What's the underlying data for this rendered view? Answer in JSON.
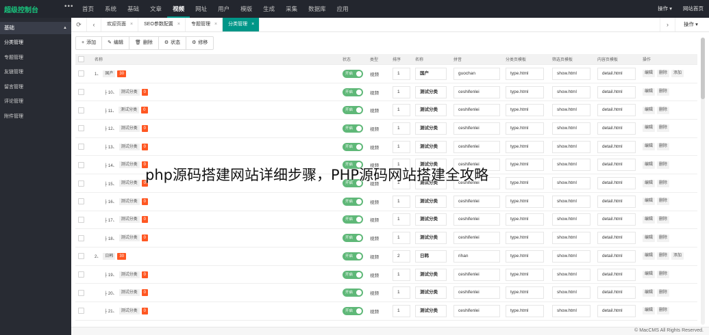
{
  "app": {
    "title": "超级控制台",
    "more": "•••"
  },
  "topnav": [
    "首页",
    "系统",
    "基础",
    "文章",
    "视频",
    "网址",
    "用户",
    "模版",
    "生成",
    "采集",
    "数据库",
    "应用"
  ],
  "topnav_active": 4,
  "top_right": {
    "ops": "操作 ▾",
    "home": "网站首页"
  },
  "sidebar": {
    "header": "基础",
    "items": [
      "分类管理",
      "专题管理",
      "友链管理",
      "留言管理",
      "评论管理",
      "附件管理"
    ],
    "active": 0
  },
  "tabbar": {
    "tabs": [
      {
        "label": "欢迎页面"
      },
      {
        "label": "SEO参数配置"
      },
      {
        "label": "专题管理"
      },
      {
        "label": "分类管理"
      }
    ],
    "active": 3,
    "close": "×",
    "ops": "操作 ▾"
  },
  "toolbar": [
    {
      "icon": "plus-icon",
      "glyph": "+",
      "label": "添加"
    },
    {
      "icon": "edit-icon",
      "glyph": "✎",
      "label": "编辑"
    },
    {
      "icon": "delete-icon",
      "glyph": "🗑",
      "label": "删除"
    },
    {
      "icon": "gear-icon",
      "glyph": "⚙",
      "label": "状态"
    },
    {
      "icon": "gear-icon",
      "glyph": "⚙",
      "label": "修移"
    }
  ],
  "columns": [
    "名称",
    "状态",
    "类型",
    "排序",
    "名称",
    "拼音",
    "分类页模板",
    "筛选页模板",
    "内容页模板",
    "操作"
  ],
  "switch_label": "开启",
  "ops": {
    "edit": "编辑",
    "delete": "删除",
    "add": "添加"
  },
  "rows": [
    {
      "level": 1,
      "prefix": "1、",
      "name": "国产",
      "badge": "30",
      "type": "视频",
      "sort": "1",
      "name_field": "国产",
      "pinyin": "guochan",
      "list_tpl": "type.html",
      "filter_tpl": "show.html",
      "detail_tpl": "detail.html"
    },
    {
      "level": 2,
      "prefix": "├ 10、",
      "name": "测试分类",
      "badge": "0",
      "type": "视频",
      "sort": "1",
      "name_field": "测试分类",
      "pinyin": "ceshifenlei",
      "list_tpl": "type.html",
      "filter_tpl": "show.html",
      "detail_tpl": "detail.html"
    },
    {
      "level": 2,
      "prefix": "├ 11、",
      "name": "测试分类",
      "badge": "0",
      "type": "视频",
      "sort": "1",
      "name_field": "测试分类",
      "pinyin": "ceshifenlei",
      "list_tpl": "type.html",
      "filter_tpl": "show.html",
      "detail_tpl": "detail.html"
    },
    {
      "level": 2,
      "prefix": "├ 12、",
      "name": "测试分类",
      "badge": "0",
      "type": "视频",
      "sort": "1",
      "name_field": "测试分类",
      "pinyin": "ceshifenlei",
      "list_tpl": "type.html",
      "filter_tpl": "show.html",
      "detail_tpl": "detail.html"
    },
    {
      "level": 2,
      "prefix": "├ 13、",
      "name": "测试分类",
      "badge": "0",
      "type": "视频",
      "sort": "1",
      "name_field": "测试分类",
      "pinyin": "ceshifenlei",
      "list_tpl": "type.html",
      "filter_tpl": "show.html",
      "detail_tpl": "detail.html"
    },
    {
      "level": 2,
      "prefix": "├ 14、",
      "name": "测试分类",
      "badge": "0",
      "type": "视频",
      "sort": "1",
      "name_field": "测试分类",
      "pinyin": "ceshifenlei",
      "list_tpl": "type.html",
      "filter_tpl": "show.html",
      "detail_tpl": "detail.html"
    },
    {
      "level": 2,
      "prefix": "├ 15、",
      "name": "测试分类",
      "badge": "0",
      "type": "视频",
      "sort": "1",
      "name_field": "测试分类",
      "pinyin": "ceshifenlei",
      "list_tpl": "type.html",
      "filter_tpl": "show.html",
      "detail_tpl": "detail.html"
    },
    {
      "level": 2,
      "prefix": "├ 16、",
      "name": "测试分类",
      "badge": "0",
      "type": "视频",
      "sort": "1",
      "name_field": "测试分类",
      "pinyin": "ceshifenlei",
      "list_tpl": "type.html",
      "filter_tpl": "show.html",
      "detail_tpl": "detail.html"
    },
    {
      "level": 2,
      "prefix": "├ 17、",
      "name": "测试分类",
      "badge": "0",
      "type": "视频",
      "sort": "1",
      "name_field": "测试分类",
      "pinyin": "ceshifenlei",
      "list_tpl": "type.html",
      "filter_tpl": "show.html",
      "detail_tpl": "detail.html"
    },
    {
      "level": 2,
      "prefix": "├ 18、",
      "name": "测试分类",
      "badge": "0",
      "type": "视频",
      "sort": "1",
      "name_field": "测试分类",
      "pinyin": "ceshifenlei",
      "list_tpl": "type.html",
      "filter_tpl": "show.html",
      "detail_tpl": "detail.html"
    },
    {
      "level": 1,
      "prefix": "2、",
      "name": "日韩",
      "badge": "30",
      "type": "视频",
      "sort": "2",
      "name_field": "日韩",
      "pinyin": "rihan",
      "list_tpl": "type.html",
      "filter_tpl": "show.html",
      "detail_tpl": "detail.html"
    },
    {
      "level": 2,
      "prefix": "├ 19、",
      "name": "测试分类",
      "badge": "0",
      "type": "视频",
      "sort": "1",
      "name_field": "测试分类",
      "pinyin": "ceshifenlei",
      "list_tpl": "type.html",
      "filter_tpl": "show.html",
      "detail_tpl": "detail.html"
    },
    {
      "level": 2,
      "prefix": "├ 20、",
      "name": "测试分类",
      "badge": "0",
      "type": "视频",
      "sort": "1",
      "name_field": "测试分类",
      "pinyin": "ceshifenlei",
      "list_tpl": "type.html",
      "filter_tpl": "show.html",
      "detail_tpl": "detail.html"
    },
    {
      "level": 2,
      "prefix": "├ 21、",
      "name": "测试分类",
      "badge": "0",
      "type": "视频",
      "sort": "1",
      "name_field": "测试分类",
      "pinyin": "ceshifenlei",
      "list_tpl": "type.html",
      "filter_tpl": "show.html",
      "detail_tpl": "detail.html"
    }
  ],
  "watermark": "php源码搭建网站详细步骤，PHP源码网站搭建全攻略",
  "footer": "© MacCMS All Rights Reserved.",
  "colors": {
    "accent": "#009688",
    "switch_on": "#5fb878",
    "badge": "#ff5722",
    "topbar": "#23262e",
    "sidebar": "#282b33"
  }
}
